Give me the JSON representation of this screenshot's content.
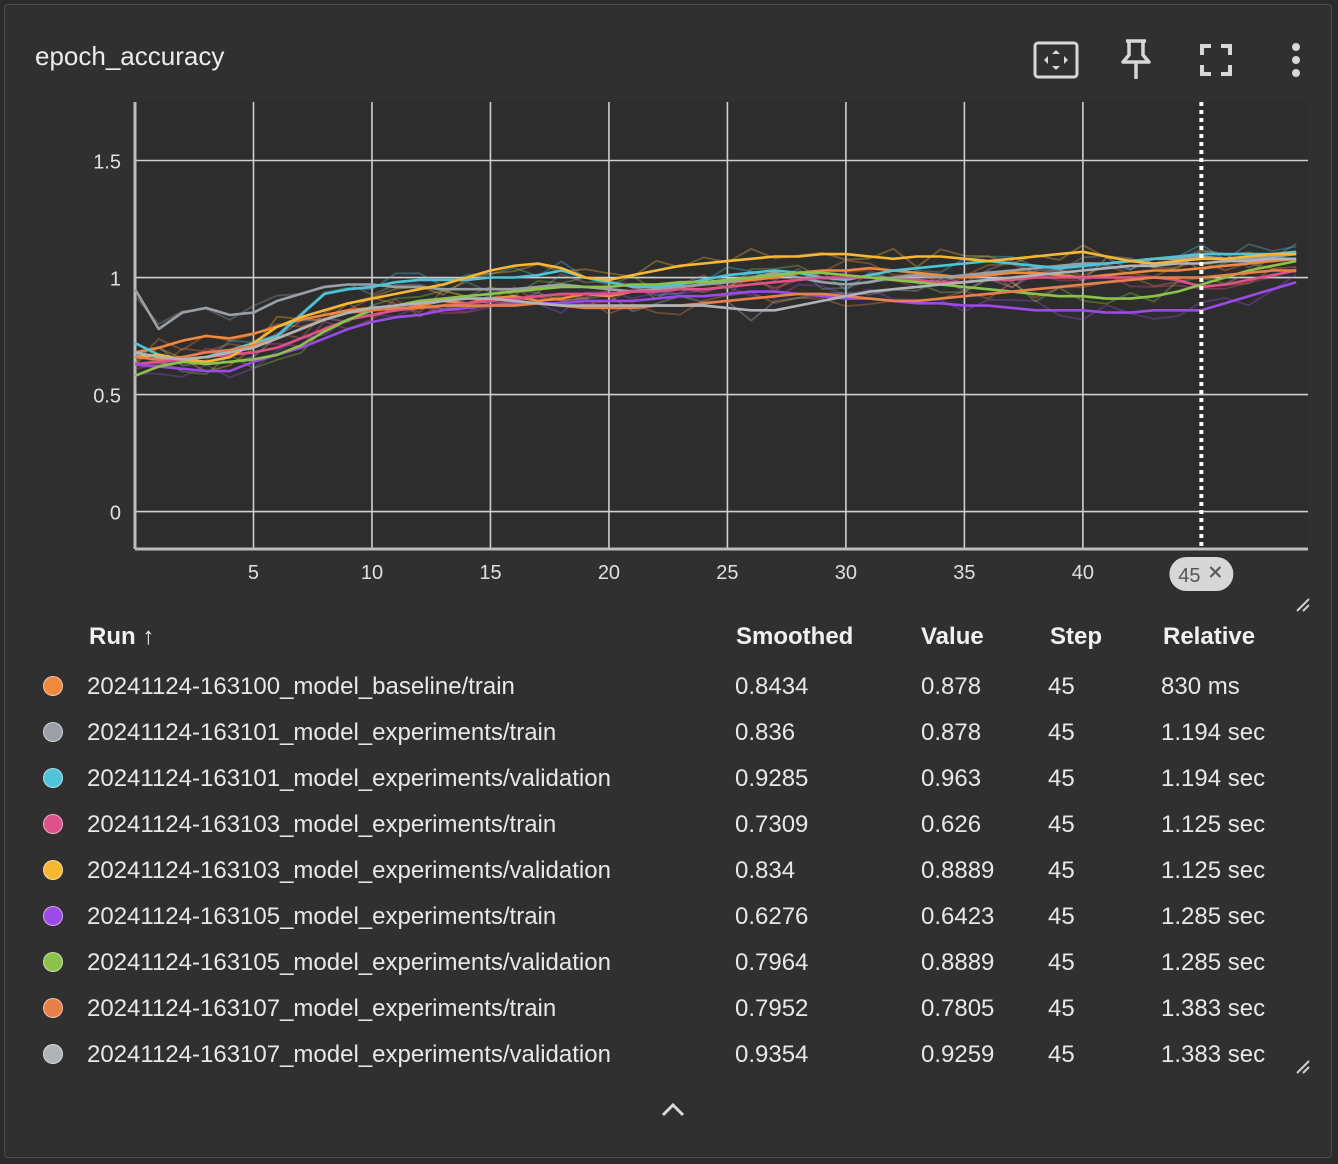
{
  "card": {
    "title": "epoch_accuracy"
  },
  "toolbar": {
    "fit_icon": "fit-domain-icon",
    "pin_icon": "pin-icon",
    "fullscreen_icon": "fullscreen-icon",
    "more_icon": "more-vert-icon"
  },
  "chart_data": {
    "type": "line",
    "xlim": [
      0,
      49.5
    ],
    "ylim": [
      -0.16,
      1.75
    ],
    "x_ticks": [
      5,
      10,
      15,
      20,
      25,
      30,
      35,
      40
    ],
    "x_tick_labels": [
      "5",
      "10",
      "15",
      "20",
      "25",
      "30",
      "35",
      "40"
    ],
    "y_ticks": [
      0,
      0.5,
      1,
      1.5
    ],
    "y_tick_labels": [
      "0",
      "0.5",
      "1",
      "1.5"
    ],
    "grid": true,
    "cursor_step": 45,
    "cursor_label": "45",
    "steps": [
      0,
      1,
      2,
      3,
      4,
      5,
      6,
      7,
      8,
      9,
      10,
      11,
      12,
      13,
      14,
      15,
      16,
      17,
      18,
      19,
      20,
      21,
      22,
      23,
      24,
      25,
      26,
      27,
      28,
      29,
      30,
      31,
      32,
      33,
      34,
      35,
      36,
      37,
      38,
      39,
      40,
      41,
      42,
      43,
      44,
      45,
      46,
      47,
      48,
      49
    ],
    "series": [
      {
        "color": "#f0883e",
        "values": [
          0.68,
          0.7,
          0.73,
          0.75,
          0.74,
          0.76,
          0.79,
          0.82,
          0.84,
          0.86,
          0.87,
          0.86,
          0.88,
          0.9,
          0.89,
          0.91,
          0.92,
          0.9,
          0.91,
          0.93,
          0.92,
          0.94,
          0.95,
          0.96,
          0.97,
          0.98,
          0.99,
          1.0,
          1.02,
          1.03,
          1.03,
          1.04,
          1.03,
          1.02,
          1.01,
          1.0,
          1.01,
          1.02,
          1.02,
          1.01,
          1.0,
          1.01,
          1.02,
          1.03,
          1.03,
          1.04,
          1.05,
          1.06,
          1.07,
          1.08
        ]
      },
      {
        "color": "#9aa0a6",
        "values": [
          0.95,
          0.78,
          0.85,
          0.87,
          0.84,
          0.85,
          0.9,
          0.93,
          0.96,
          0.97,
          0.97,
          0.96,
          0.96,
          0.95,
          0.95,
          0.95,
          0.95,
          0.96,
          0.97,
          0.96,
          0.95,
          0.94,
          0.95,
          0.96,
          0.97,
          0.98,
          1.0,
          1.02,
          1.0,
          0.98,
          0.97,
          0.98,
          1.0,
          1.01,
          1.0,
          1.01,
          1.02,
          1.03,
          1.04,
          1.05,
          1.06,
          1.06,
          1.07,
          1.08,
          1.08,
          1.09,
          1.08,
          1.08,
          1.09,
          1.1
        ]
      },
      {
        "color": "#4fc3d9",
        "values": [
          0.72,
          0.67,
          0.65,
          0.66,
          0.69,
          0.72,
          0.75,
          0.84,
          0.93,
          0.95,
          0.96,
          0.98,
          0.99,
          0.99,
          0.99,
          1.0,
          1.0,
          1.01,
          1.03,
          1.0,
          0.98,
          0.96,
          0.96,
          0.97,
          0.99,
          1.01,
          1.02,
          1.03,
          1.02,
          1.0,
          0.99,
          1.01,
          1.03,
          1.04,
          1.05,
          1.06,
          1.07,
          1.06,
          1.05,
          1.04,
          1.05,
          1.06,
          1.07,
          1.08,
          1.09,
          1.1,
          1.1,
          1.1,
          1.1,
          1.11
        ]
      },
      {
        "color": "#e0508a",
        "values": [
          0.63,
          0.64,
          0.65,
          0.66,
          0.67,
          0.68,
          0.7,
          0.74,
          0.78,
          0.82,
          0.84,
          0.86,
          0.87,
          0.88,
          0.89,
          0.9,
          0.91,
          0.92,
          0.93,
          0.93,
          0.93,
          0.94,
          0.94,
          0.95,
          0.95,
          0.96,
          0.97,
          0.98,
          0.99,
          1.0,
          1.0,
          1.0,
          0.99,
          0.99,
          0.98,
          0.98,
          0.99,
          0.99,
          1.0,
          1.0,
          1.0,
          1.0,
          1.0,
          1.0,
          0.99,
          0.96,
          0.97,
          0.99,
          1.01,
          1.03
        ]
      },
      {
        "color": "#f7b733",
        "values": [
          0.66,
          0.67,
          0.65,
          0.64,
          0.66,
          0.72,
          0.79,
          0.83,
          0.86,
          0.89,
          0.91,
          0.93,
          0.95,
          0.97,
          1.0,
          1.03,
          1.05,
          1.06,
          1.04,
          1.0,
          0.99,
          1.01,
          1.03,
          1.05,
          1.06,
          1.07,
          1.08,
          1.09,
          1.09,
          1.1,
          1.1,
          1.09,
          1.08,
          1.09,
          1.09,
          1.08,
          1.07,
          1.08,
          1.09,
          1.1,
          1.11,
          1.09,
          1.07,
          1.06,
          1.07,
          1.08,
          1.08,
          1.09,
          1.1,
          1.1
        ]
      },
      {
        "color": "#9b4ae8",
        "values": [
          0.63,
          0.62,
          0.61,
          0.6,
          0.6,
          0.64,
          0.67,
          0.7,
          0.74,
          0.78,
          0.81,
          0.83,
          0.84,
          0.86,
          0.87,
          0.88,
          0.89,
          0.89,
          0.89,
          0.9,
          0.9,
          0.9,
          0.91,
          0.92,
          0.92,
          0.93,
          0.94,
          0.94,
          0.93,
          0.92,
          0.91,
          0.91,
          0.9,
          0.89,
          0.89,
          0.88,
          0.88,
          0.87,
          0.86,
          0.86,
          0.86,
          0.85,
          0.85,
          0.86,
          0.86,
          0.86,
          0.89,
          0.92,
          0.95,
          0.98
        ]
      },
      {
        "color": "#8bc34a",
        "values": [
          0.58,
          0.62,
          0.64,
          0.63,
          0.64,
          0.65,
          0.67,
          0.71,
          0.77,
          0.82,
          0.86,
          0.88,
          0.9,
          0.91,
          0.92,
          0.93,
          0.94,
          0.95,
          0.96,
          0.96,
          0.96,
          0.97,
          0.97,
          0.98,
          0.98,
          0.99,
          1.0,
          1.01,
          1.02,
          1.02,
          1.01,
          1.0,
          0.99,
          0.98,
          0.97,
          0.96,
          0.95,
          0.94,
          0.93,
          0.92,
          0.92,
          0.91,
          0.91,
          0.92,
          0.94,
          0.97,
          1.0,
          1.03,
          1.05,
          1.07
        ]
      },
      {
        "color": "#e8804a",
        "values": [
          0.66,
          0.65,
          0.66,
          0.68,
          0.69,
          0.71,
          0.74,
          0.78,
          0.82,
          0.85,
          0.86,
          0.87,
          0.87,
          0.88,
          0.88,
          0.88,
          0.88,
          0.89,
          0.88,
          0.87,
          0.87,
          0.87,
          0.88,
          0.88,
          0.89,
          0.9,
          0.91,
          0.92,
          0.93,
          0.93,
          0.92,
          0.91,
          0.9,
          0.9,
          0.91,
          0.92,
          0.93,
          0.94,
          0.95,
          0.96,
          0.97,
          0.98,
          0.99,
          1.0,
          1.0,
          1.0,
          1.01,
          1.02,
          1.03,
          1.03
        ]
      },
      {
        "color": "#b0b4b8",
        "values": [
          0.68,
          0.66,
          0.65,
          0.66,
          0.68,
          0.7,
          0.74,
          0.78,
          0.82,
          0.85,
          0.87,
          0.88,
          0.89,
          0.9,
          0.91,
          0.91,
          0.9,
          0.89,
          0.88,
          0.88,
          0.88,
          0.88,
          0.88,
          0.88,
          0.88,
          0.87,
          0.86,
          0.86,
          0.88,
          0.9,
          0.92,
          0.94,
          0.95,
          0.96,
          0.97,
          0.98,
          0.99,
          1.0,
          1.01,
          1.02,
          1.03,
          1.04,
          1.05,
          1.05,
          1.06,
          1.06,
          1.07,
          1.07,
          1.08,
          1.08
        ]
      }
    ]
  },
  "table": {
    "headers": {
      "run": "Run",
      "sort": "↑",
      "smoothed": "Smoothed",
      "value": "Value",
      "step": "Step",
      "relative": "Relative"
    },
    "rows": [
      {
        "color": "#f0883e",
        "run": "20241124-163100_model_baseline/train",
        "smoothed": "0.8434",
        "value": "0.878",
        "step": "45",
        "relative": "830 ms"
      },
      {
        "color": "#9aa0a6",
        "run": "20241124-163101_model_experiments/train",
        "smoothed": "0.836",
        "value": "0.878",
        "step": "45",
        "relative": "1.194 sec"
      },
      {
        "color": "#4fc3d9",
        "run": "20241124-163101_model_experiments/validation",
        "smoothed": "0.9285",
        "value": "0.963",
        "step": "45",
        "relative": "1.194 sec"
      },
      {
        "color": "#e0508a",
        "run": "20241124-163103_model_experiments/train",
        "smoothed": "0.7309",
        "value": "0.626",
        "step": "45",
        "relative": "1.125 sec"
      },
      {
        "color": "#f7b733",
        "run": "20241124-163103_model_experiments/validation",
        "smoothed": "0.834",
        "value": "0.8889",
        "step": "45",
        "relative": "1.125 sec"
      },
      {
        "color": "#9b4ae8",
        "run": "20241124-163105_model_experiments/train",
        "smoothed": "0.6276",
        "value": "0.6423",
        "step": "45",
        "relative": "1.285 sec"
      },
      {
        "color": "#8bc34a",
        "run": "20241124-163105_model_experiments/validation",
        "smoothed": "0.7964",
        "value": "0.8889",
        "step": "45",
        "relative": "1.285 sec"
      },
      {
        "color": "#e8804a",
        "run": "20241124-163107_model_experiments/train",
        "smoothed": "0.7952",
        "value": "0.7805",
        "step": "45",
        "relative": "1.383 sec"
      },
      {
        "color": "#b0b4b8",
        "run": "20241124-163107_model_experiments/validation",
        "smoothed": "0.9354",
        "value": "0.9259",
        "step": "45",
        "relative": "1.383 sec"
      }
    ]
  },
  "footer": {
    "collapse_icon": "chevron-up-icon"
  }
}
